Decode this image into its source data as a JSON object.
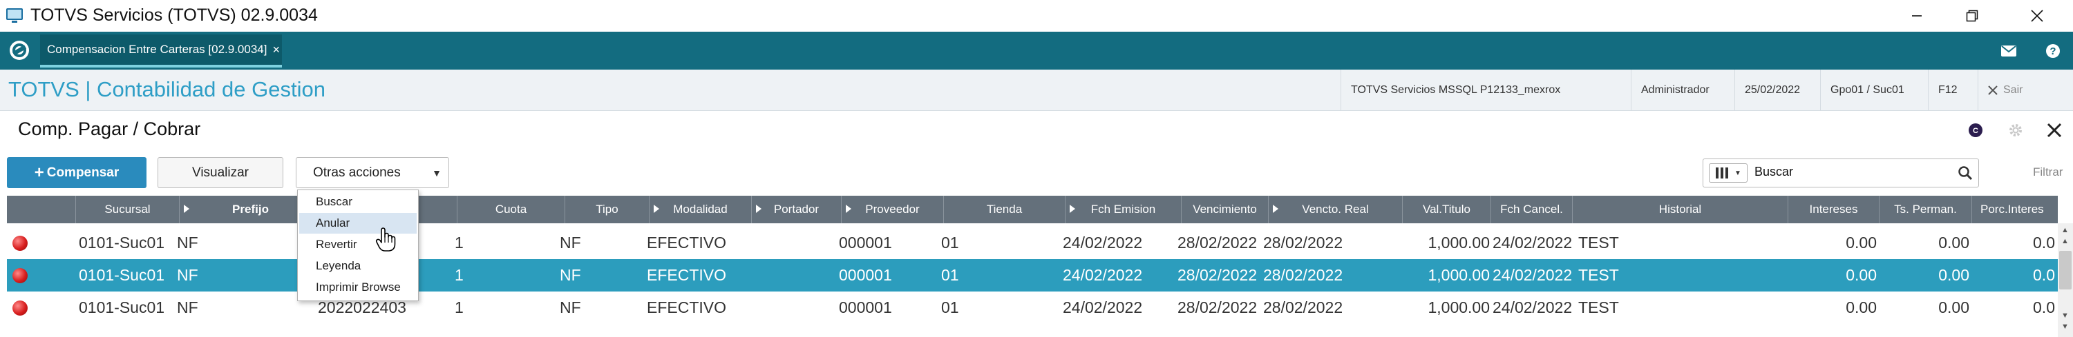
{
  "window": {
    "title": "TOTVS Servicios (TOTVS) 02.9.0034"
  },
  "tab": {
    "label": "Compensacion Entre Carteras [02.9.0034]",
    "close": "×"
  },
  "module": {
    "title": "TOTVS | Contabilidad de Gestion"
  },
  "status": {
    "server": "TOTVS Servicios MSSQL P12133_mexrox",
    "user": "Administrador",
    "date": "25/02/2022",
    "group": "Gpo01 / Suc01",
    "key": "F12",
    "exit": "Sair"
  },
  "page": {
    "title": "Comp. Pagar / Cobrar"
  },
  "toolbar": {
    "compensar": "Compensar",
    "visualizar": "Visualizar",
    "otras": "Otras acciones"
  },
  "search": {
    "value": "Buscar"
  },
  "filter": {
    "label": "Filtrar"
  },
  "grid": {
    "headers": [
      "Sucursal",
      "Prefijo",
      "",
      "Cuota",
      "Tipo",
      "Modalidad",
      "Portador",
      "Proveedor",
      "Tienda",
      "Fch Emision",
      "Vencimiento",
      "Vencto. Real",
      "Val.Titulo",
      "Fch Cancel.",
      "Historial",
      "Intereses",
      "Ts. Perman.",
      "Porc.Interes"
    ],
    "rows": [
      {
        "sucursal": "0101-Suc01",
        "prefijo": "NF",
        "numero": "",
        "cuota": "1",
        "tipo": "NF",
        "modalidad": "EFECTIVO",
        "portador": "",
        "proveedor": "000001",
        "tienda": "01",
        "emision": "24/02/2022",
        "vencimiento": "28/02/2022",
        "vencto_real": "28/02/2022",
        "valor": "1,000.00",
        "cancel": "24/02/2022",
        "historial": "TEST",
        "intereses": "0.00",
        "perman": "0.00",
        "porc": "0.0"
      },
      {
        "sucursal": "0101-Suc01",
        "prefijo": "NF",
        "numero": "",
        "cuota": "1",
        "tipo": "NF",
        "modalidad": "EFECTIVO",
        "portador": "",
        "proveedor": "000001",
        "tienda": "01",
        "emision": "24/02/2022",
        "vencimiento": "28/02/2022",
        "vencto_real": "28/02/2022",
        "valor": "1,000.00",
        "cancel": "24/02/2022",
        "historial": "TEST",
        "intereses": "0.00",
        "perman": "0.00",
        "porc": "0.0"
      },
      {
        "sucursal": "0101-Suc01",
        "prefijo": "NF",
        "numero": "2022022403",
        "cuota": "1",
        "tipo": "NF",
        "modalidad": "EFECTIVO",
        "portador": "",
        "proveedor": "000001",
        "tienda": "01",
        "emision": "24/02/2022",
        "vencimiento": "28/02/2022",
        "vencto_real": "28/02/2022",
        "valor": "1,000.00",
        "cancel": "24/02/2022",
        "historial": "TEST",
        "intereses": "0.00",
        "perman": "0.00",
        "porc": "0.0"
      }
    ]
  },
  "menu": {
    "items": [
      "Buscar",
      "Anular",
      "Revertir",
      "Leyenda",
      "Imprimir Browse"
    ],
    "hovered_index": 1
  },
  "colors": {
    "tabbar": "#136c80",
    "accent": "#2e9ec6",
    "selected_row": "#2c9dbd",
    "header": "#64707b",
    "primary_button": "#2a8bbd"
  },
  "icons": [
    "app-icon",
    "minimize-icon",
    "maximize-icon",
    "close-icon",
    "totvs-logo-icon",
    "mail-icon",
    "help-icon",
    "close-x-icon",
    "circle-c-icon",
    "gear-icon",
    "columns-icon",
    "search-icon",
    "status-red-dot-icon",
    "hand-cursor-icon"
  ]
}
